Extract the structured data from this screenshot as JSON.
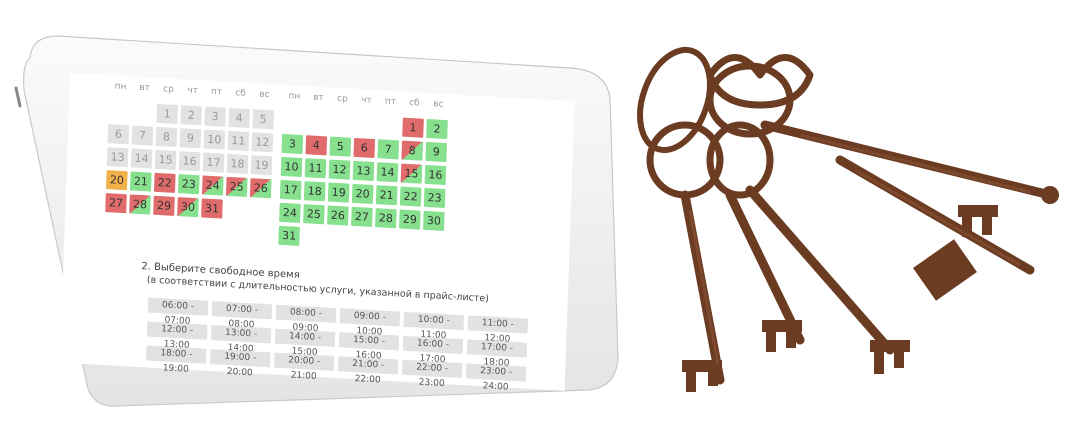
{
  "calendar": {
    "weekdays": [
      "пн",
      "вт",
      "ср",
      "чт",
      "пт",
      "сб",
      "вс"
    ],
    "month1": [
      {
        "d": "1",
        "s": "empty"
      },
      {
        "d": "2",
        "s": "empty"
      },
      {
        "d": "3",
        "s": "empty"
      },
      {
        "d": "4",
        "s": "empty"
      },
      {
        "d": "5",
        "s": "empty"
      },
      {
        "d": "6",
        "s": "empty"
      },
      {
        "d": "7",
        "s": "empty"
      },
      {
        "d": "8",
        "s": "empty"
      },
      {
        "d": "9",
        "s": "empty"
      },
      {
        "d": "10",
        "s": "empty"
      },
      {
        "d": "11",
        "s": "empty"
      },
      {
        "d": "12",
        "s": "empty"
      },
      {
        "d": "13",
        "s": "empty"
      },
      {
        "d": "14",
        "s": "empty"
      },
      {
        "d": "15",
        "s": "empty"
      },
      {
        "d": "16",
        "s": "empty"
      },
      {
        "d": "17",
        "s": "empty"
      },
      {
        "d": "18",
        "s": "empty"
      },
      {
        "d": "19",
        "s": "empty"
      },
      {
        "d": "20",
        "s": "today"
      },
      {
        "d": "21",
        "s": "free"
      },
      {
        "d": "22",
        "s": "busy"
      },
      {
        "d": "23",
        "s": "free"
      },
      {
        "d": "24",
        "s": "part"
      },
      {
        "d": "25",
        "s": "part"
      },
      {
        "d": "26",
        "s": "part"
      },
      {
        "d": "27",
        "s": "busy"
      },
      {
        "d": "28",
        "s": "part"
      },
      {
        "d": "29",
        "s": "busy"
      },
      {
        "d": "30",
        "s": "part"
      },
      {
        "d": "31",
        "s": "busy"
      }
    ],
    "month2": [
      {
        "d": "1",
        "s": "busy"
      },
      {
        "d": "2",
        "s": "free"
      },
      {
        "d": "3",
        "s": "free"
      },
      {
        "d": "4",
        "s": "busy"
      },
      {
        "d": "5",
        "s": "free"
      },
      {
        "d": "6",
        "s": "busy"
      },
      {
        "d": "7",
        "s": "free"
      },
      {
        "d": "8",
        "s": "part"
      },
      {
        "d": "9",
        "s": "free"
      },
      {
        "d": "10",
        "s": "free"
      },
      {
        "d": "11",
        "s": "free"
      },
      {
        "d": "12",
        "s": "free"
      },
      {
        "d": "13",
        "s": "free"
      },
      {
        "d": "14",
        "s": "free"
      },
      {
        "d": "15",
        "s": "part"
      },
      {
        "d": "16",
        "s": "free"
      },
      {
        "d": "17",
        "s": "free"
      },
      {
        "d": "18",
        "s": "free"
      },
      {
        "d": "19",
        "s": "free"
      },
      {
        "d": "20",
        "s": "free"
      },
      {
        "d": "21",
        "s": "free"
      },
      {
        "d": "22",
        "s": "free"
      },
      {
        "d": "23",
        "s": "free"
      },
      {
        "d": "24",
        "s": "free"
      },
      {
        "d": "25",
        "s": "free"
      },
      {
        "d": "26",
        "s": "free"
      },
      {
        "d": "27",
        "s": "free"
      },
      {
        "d": "28",
        "s": "free"
      },
      {
        "d": "29",
        "s": "free"
      },
      {
        "d": "30",
        "s": "free"
      },
      {
        "d": "31",
        "s": "free"
      }
    ],
    "colors": {
      "free": "#86e08e",
      "busy": "#e06b6b",
      "today": "#f0b14a",
      "empty": "#e2e2e2"
    }
  },
  "time": {
    "title": "2. Выберите свободное время",
    "note": "(в соответствии с длительностью услуги, указанной в прайс-листе)",
    "slots": [
      "06:00 - 07:00",
      "07:00 - 08:00",
      "08:00 - 09:00",
      "09:00 - 10:00",
      "10:00 - 11:00",
      "11:00 - 12:00",
      "12:00 - 13:00",
      "13:00 - 14:00",
      "14:00 - 15:00",
      "15:00 - 16:00",
      "16:00 - 17:00",
      "17:00 - 18:00",
      "18:00 - 19:00",
      "19:00 - 20:00",
      "20:00 - 21:00",
      "21:00 - 22:00",
      "22:00 - 23:00",
      "23:00 - 24:00"
    ]
  }
}
